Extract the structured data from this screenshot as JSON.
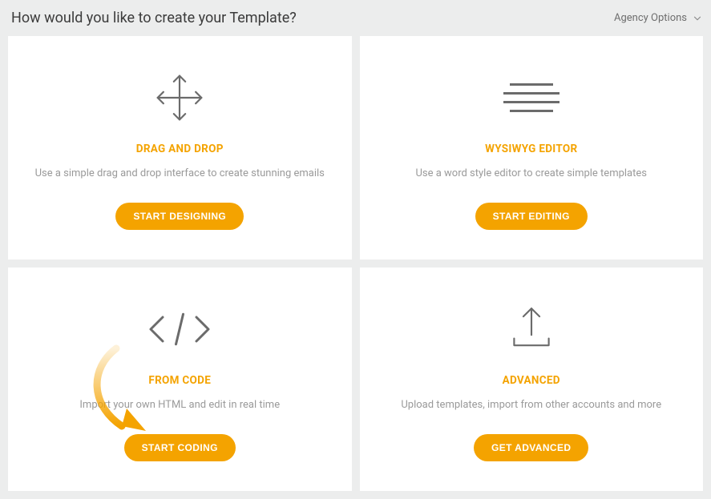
{
  "header": {
    "title": "How would you like to create your Template?",
    "agency_label": "Agency Options"
  },
  "cards": {
    "dragdrop": {
      "title": "DRAG AND DROP",
      "desc": "Use a simple drag and drop interface to create stunning emails",
      "cta": "START DESIGNING"
    },
    "wysiwyg": {
      "title": "WYSIWYG EDITOR",
      "desc": "Use a word style editor to create simple templates",
      "cta": "START EDITING"
    },
    "fromcode": {
      "title": "FROM CODE",
      "desc": "Import your own HTML and edit in real time",
      "cta": "START CODING"
    },
    "advanced": {
      "title": "ADVANCED",
      "desc": "Upload templates, import from other accounts and more",
      "cta": "GET ADVANCED"
    }
  }
}
